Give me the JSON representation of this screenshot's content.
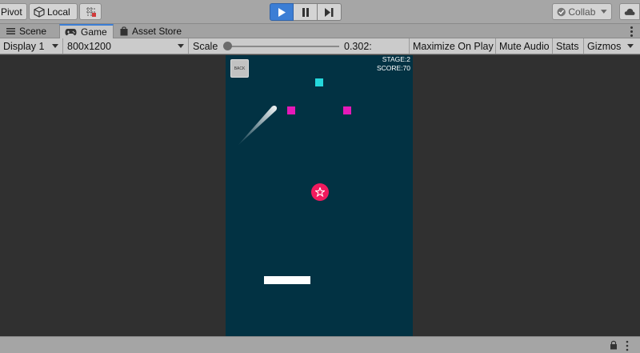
{
  "toolbar": {
    "pivot_label": "Pivot",
    "local_label": "Local",
    "snap_icon": "grid-snap-icon",
    "play_icon": "play-icon",
    "pause_icon": "pause-icon",
    "step_icon": "step-icon",
    "collab_label": "Collab",
    "cloud_icon": "cloud-icon",
    "play_color": "#3c7ed5"
  },
  "tabs": [
    {
      "label": "Scene",
      "icon": "scene-menu-icon"
    },
    {
      "label": "Game",
      "icon": "gamepad-icon",
      "active": true
    },
    {
      "label": "Asset Store",
      "icon": "store-bag-icon"
    }
  ],
  "game_toolbar": {
    "display": "Display 1",
    "resolution": "800x1200",
    "scale_label": "Scale",
    "scale_value": "0.302:",
    "maximize": "Maximize On Play",
    "mute": "Mute Audio",
    "stats": "Stats",
    "gizmos": "Gizmos"
  },
  "game": {
    "background_color": "#023243",
    "back_label": "BACK",
    "stage": "STAGE:2",
    "score": "SCORE:70",
    "ball_color": "#f21a5e",
    "cyan_block_color": "#25d8dc",
    "magenta_block_color": "#e619b8",
    "paddle_color": "#ffffff"
  }
}
